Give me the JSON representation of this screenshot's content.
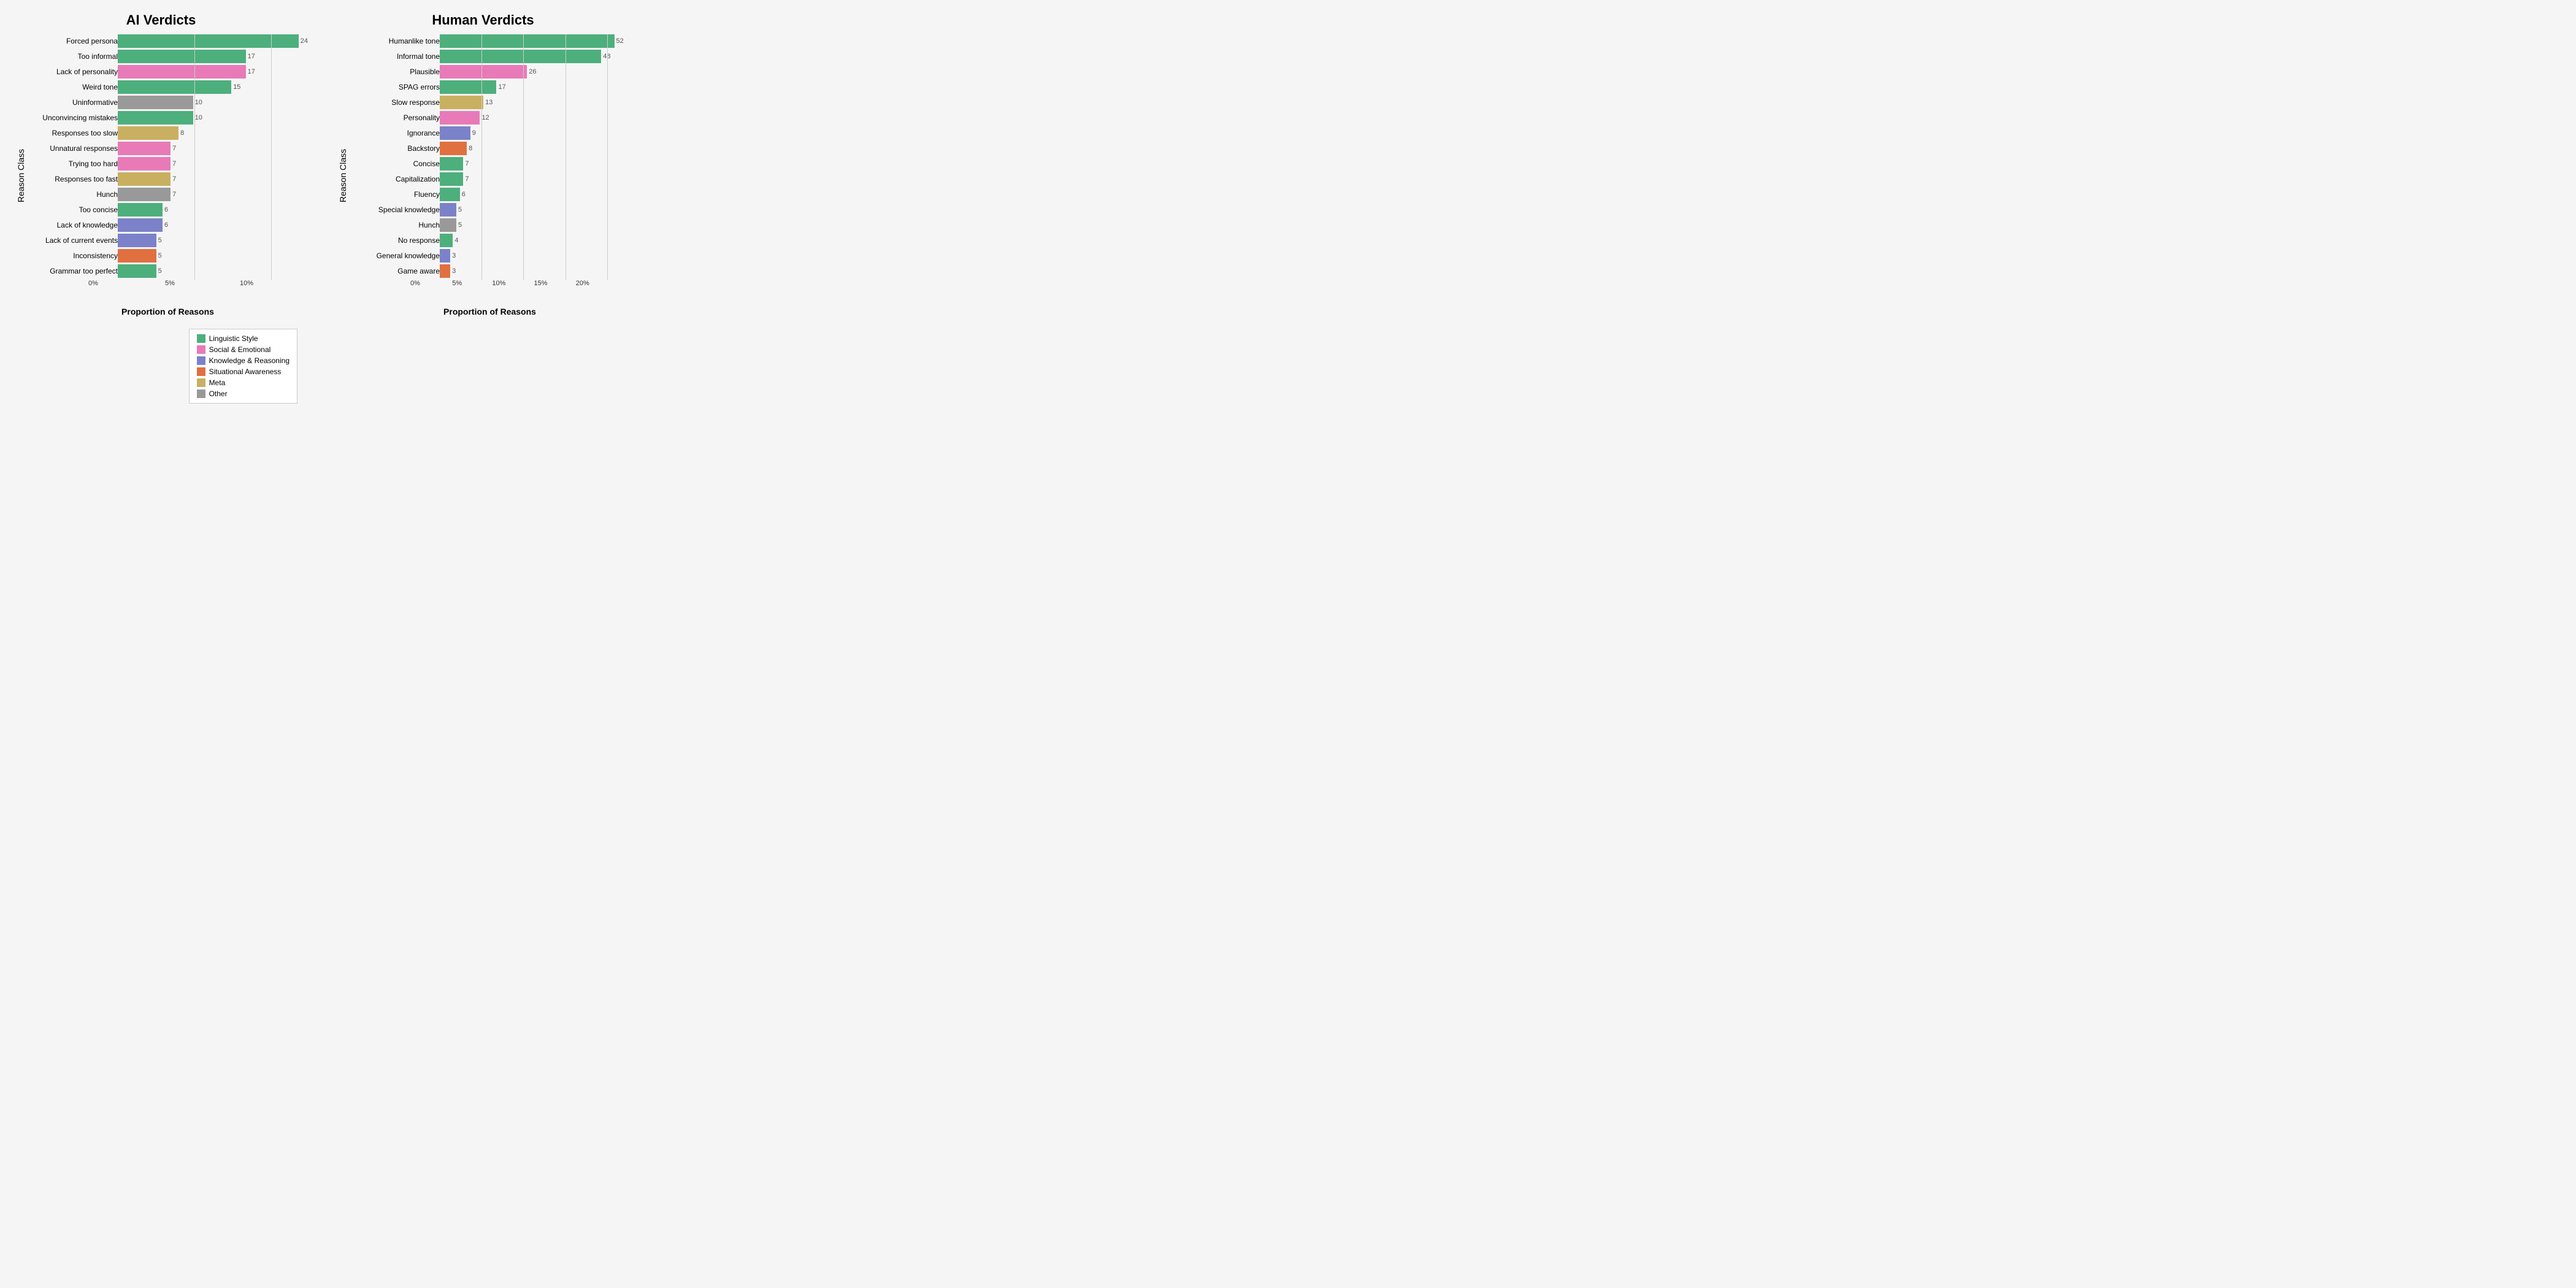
{
  "colors": {
    "linguistic": "#4daf7c",
    "social": "#e87ab8",
    "knowledge": "#7b82c9",
    "situational": "#e07040",
    "meta": "#c9b060",
    "other": "#999999"
  },
  "left_chart": {
    "title": "AI Verdicts",
    "y_axis_label": "Reason Class",
    "x_axis_label": "Proportion of Reasons",
    "max_pct": 12,
    "x_ticks": [
      {
        "label": "0%",
        "pct": 0
      },
      {
        "label": "5%",
        "pct": 5
      },
      {
        "label": "10%",
        "pct": 10
      }
    ],
    "bars": [
      {
        "label": "Forced persona",
        "value": 24,
        "pct": 11.3,
        "color": "linguistic"
      },
      {
        "label": "Too informal",
        "value": 17,
        "pct": 8.0,
        "color": "linguistic"
      },
      {
        "label": "Lack of personality",
        "value": 17,
        "pct": 8.0,
        "color": "social"
      },
      {
        "label": "Weird tone",
        "value": 15,
        "pct": 7.1,
        "color": "linguistic"
      },
      {
        "label": "Uninformative",
        "value": 10,
        "pct": 4.7,
        "color": "other"
      },
      {
        "label": "Unconvincing mistakes",
        "value": 10,
        "pct": 4.7,
        "color": "linguistic"
      },
      {
        "label": "Responses too slow",
        "value": 8,
        "pct": 3.8,
        "color": "meta"
      },
      {
        "label": "Unnatural responses",
        "value": 7,
        "pct": 3.3,
        "color": "social"
      },
      {
        "label": "Trying too hard",
        "value": 7,
        "pct": 3.3,
        "color": "social"
      },
      {
        "label": "Responses too fast",
        "value": 7,
        "pct": 3.3,
        "color": "meta"
      },
      {
        "label": "Hunch",
        "value": 7,
        "pct": 3.3,
        "color": "other"
      },
      {
        "label": "Too concise",
        "value": 6,
        "pct": 2.8,
        "color": "linguistic"
      },
      {
        "label": "Lack of knowledge",
        "value": 6,
        "pct": 2.8,
        "color": "knowledge"
      },
      {
        "label": "Lack of current events",
        "value": 5,
        "pct": 2.4,
        "color": "knowledge"
      },
      {
        "label": "Inconsistency",
        "value": 5,
        "pct": 2.4,
        "color": "situational"
      },
      {
        "label": "Grammar too perfect",
        "value": 5,
        "pct": 2.4,
        "color": "linguistic"
      }
    ]
  },
  "right_chart": {
    "title": "Human Verdicts",
    "y_axis_label": "Reason Class",
    "x_axis_label": "Proportion of Reasons",
    "max_pct": 22,
    "x_ticks": [
      {
        "label": "0%",
        "pct": 0
      },
      {
        "label": "5%",
        "pct": 5
      },
      {
        "label": "10%",
        "pct": 10
      },
      {
        "label": "15%",
        "pct": 15
      },
      {
        "label": "20%",
        "pct": 20
      }
    ],
    "bars": [
      {
        "label": "Humanlike tone",
        "value": 52,
        "pct": 20.0,
        "color": "linguistic"
      },
      {
        "label": "Informal tone",
        "value": 48,
        "pct": 18.5,
        "color": "linguistic"
      },
      {
        "label": "Plausible",
        "value": 26,
        "pct": 10.0,
        "color": "social"
      },
      {
        "label": "SPAG errors",
        "value": 17,
        "pct": 6.5,
        "color": "linguistic"
      },
      {
        "label": "Slow response",
        "value": 13,
        "pct": 5.0,
        "color": "meta"
      },
      {
        "label": "Personality",
        "value": 12,
        "pct": 4.6,
        "color": "social"
      },
      {
        "label": "Ignorance",
        "value": 9,
        "pct": 3.5,
        "color": "knowledge"
      },
      {
        "label": "Backstory",
        "value": 8,
        "pct": 3.1,
        "color": "situational"
      },
      {
        "label": "Concise",
        "value": 7,
        "pct": 2.7,
        "color": "linguistic"
      },
      {
        "label": "Capitalization",
        "value": 7,
        "pct": 2.7,
        "color": "linguistic"
      },
      {
        "label": "Fluency",
        "value": 6,
        "pct": 2.3,
        "color": "linguistic"
      },
      {
        "label": "Special knowledge",
        "value": 5,
        "pct": 1.9,
        "color": "knowledge"
      },
      {
        "label": "Hunch",
        "value": 5,
        "pct": 1.9,
        "color": "other"
      },
      {
        "label": "No response",
        "value": 4,
        "pct": 1.5,
        "color": "linguistic"
      },
      {
        "label": "General knowledge",
        "value": 3,
        "pct": 1.2,
        "color": "knowledge"
      },
      {
        "label": "Game aware",
        "value": 3,
        "pct": 1.2,
        "color": "situational"
      }
    ]
  },
  "legend": {
    "items": [
      {
        "label": "Linguistic Style",
        "color": "linguistic"
      },
      {
        "label": "Social & Emotional",
        "color": "social"
      },
      {
        "label": "Knowledge & Reasoning",
        "color": "knowledge"
      },
      {
        "label": "Situational Awareness",
        "color": "situational"
      },
      {
        "label": "Meta",
        "color": "meta"
      },
      {
        "label": "Other",
        "color": "other"
      }
    ]
  }
}
